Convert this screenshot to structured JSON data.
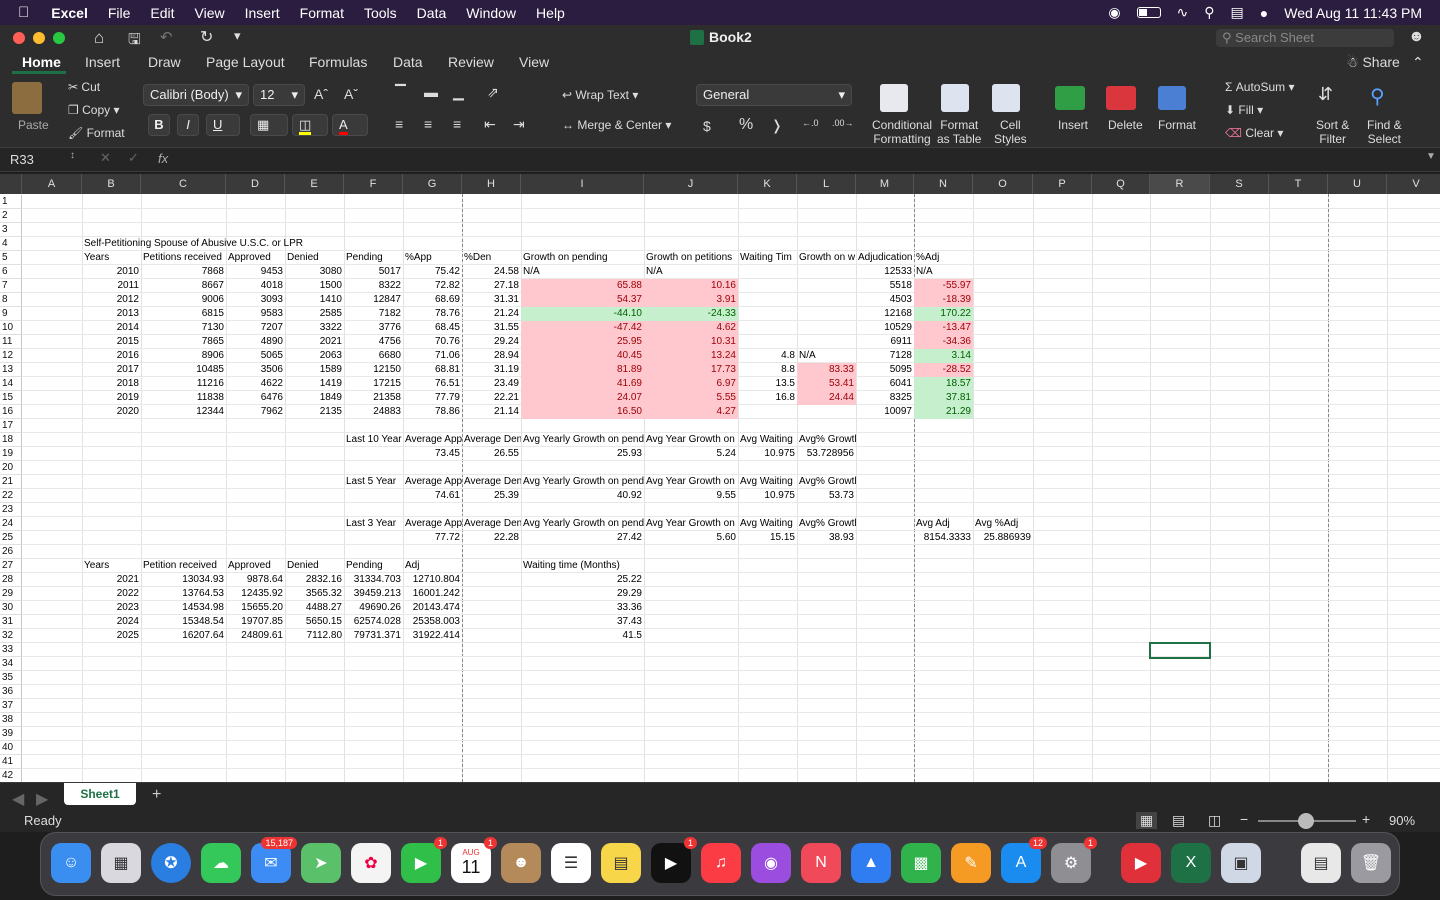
{
  "menubar": {
    "apple": "",
    "app": "Excel",
    "items": [
      "File",
      "Edit",
      "View",
      "Insert",
      "Format",
      "Tools",
      "Data",
      "Window",
      "Help"
    ],
    "clock": "Wed Aug 11  11:43 PM"
  },
  "window": {
    "title": "Book2"
  },
  "search": {
    "placeholder": "Search Sheet"
  },
  "share": {
    "label": "Share"
  },
  "ribbon_tabs": [
    "Home",
    "Insert",
    "Draw",
    "Page Layout",
    "Formulas",
    "Data",
    "Review",
    "View"
  ],
  "ribbon": {
    "paste": "Paste",
    "cut": "Cut",
    "copy": "Copy",
    "format_painter": "Format",
    "font_name": "Calibri (Body)",
    "font_size": "12",
    "bold": "B",
    "italic": "I",
    "underline": "U",
    "wrap_text": "Wrap Text",
    "merge_center": "Merge & Center",
    "number_format": "General",
    "currency": "$",
    "percent": "%",
    "comma": "❭",
    "conditional_formatting": [
      "Conditional",
      "Formatting"
    ],
    "format_as_table": [
      "Format",
      "as Table"
    ],
    "cell_styles": [
      "Cell",
      "Styles"
    ],
    "insert": "Insert",
    "delete": "Delete",
    "format": "Format",
    "autosum": "AutoSum",
    "fill": "Fill",
    "clear": "Clear",
    "sort_filter": [
      "Sort &",
      "Filter"
    ],
    "find_select": [
      "Find &",
      "Select"
    ]
  },
  "formula_bar": {
    "name_box": "R33",
    "fx": "fx",
    "content": ""
  },
  "columns": [
    "A",
    "B",
    "C",
    "D",
    "E",
    "F",
    "G",
    "H",
    "I",
    "J",
    "K",
    "L",
    "M",
    "N",
    "O",
    "P",
    "Q",
    "R",
    "S",
    "T",
    "U",
    "V"
  ],
  "rows": [
    "1",
    "2",
    "3",
    "4",
    "5",
    "6",
    "7",
    "8",
    "9",
    "10",
    "11",
    "12",
    "13",
    "14",
    "15",
    "16",
    "17",
    "18",
    "19",
    "20",
    "21",
    "22",
    "23",
    "24",
    "25",
    "26",
    "27",
    "28",
    "29",
    "30",
    "31",
    "32",
    "33",
    "34",
    "35",
    "36",
    "37",
    "38",
    "39",
    "40",
    "41",
    "42"
  ],
  "cells": {
    "B4": "Self-Petitioning Spouse of Abusive U.S.C. or LPR",
    "B5": "Years",
    "C5": "Petitions received",
    "D5": "Approved",
    "E5": "Denied",
    "F5": "Pending",
    "G5": "%App",
    "H5": "%Den",
    "I5": "Growth on pending",
    "J5": "Growth on petitions",
    "K5": "Waiting Tim",
    "L5": "Growth on w",
    "M5": "Adjudication",
    "N5": "%Adj",
    "B6": "2010",
    "C6": "7868",
    "D6": "9453",
    "E6": "3080",
    "F6": "5017",
    "G6": "75.42",
    "H6": "24.58",
    "I6": "N/A",
    "J6": "N/A",
    "M6": "12533",
    "N6": "N/A",
    "B7": "2011",
    "C7": "8667",
    "D7": "4018",
    "E7": "1500",
    "F7": "8322",
    "G7": "72.82",
    "H7": "27.18",
    "I7": "65.88",
    "J7": "10.16",
    "M7": "5518",
    "N7": "-55.97",
    "B8": "2012",
    "C8": "9006",
    "D8": "3093",
    "E8": "1410",
    "F8": "12847",
    "G8": "68.69",
    "H8": "31.31",
    "I8": "54.37",
    "J8": "3.91",
    "M8": "4503",
    "N8": "-18.39",
    "B9": "2013",
    "C9": "6815",
    "D9": "9583",
    "E9": "2585",
    "F9": "7182",
    "G9": "78.76",
    "H9": "21.24",
    "I9": "-44.10",
    "J9": "-24.33",
    "M9": "12168",
    "N9": "170.22",
    "B10": "2014",
    "C10": "7130",
    "D10": "7207",
    "E10": "3322",
    "F10": "3776",
    "G10": "68.45",
    "H10": "31.55",
    "I10": "-47.42",
    "J10": "4.62",
    "M10": "10529",
    "N10": "-13.47",
    "B11": "2015",
    "C11": "7865",
    "D11": "4890",
    "E11": "2021",
    "F11": "4756",
    "G11": "70.76",
    "H11": "29.24",
    "I11": "25.95",
    "J11": "10.31",
    "M11": "6911",
    "N11": "-34.36",
    "B12": "2016",
    "C12": "8906",
    "D12": "5065",
    "E12": "2063",
    "F12": "6680",
    "G12": "71.06",
    "H12": "28.94",
    "I12": "40.45",
    "J12": "13.24",
    "K12": "4.8",
    "L12": "N/A",
    "M12": "7128",
    "N12": "3.14",
    "B13": "2017",
    "C13": "10485",
    "D13": "3506",
    "E13": "1589",
    "F13": "12150",
    "G13": "68.81",
    "H13": "31.19",
    "I13": "81.89",
    "J13": "17.73",
    "K13": "8.8",
    "L13": "83.33",
    "M13": "5095",
    "N13": "-28.52",
    "B14": "2018",
    "C14": "11216",
    "D14": "4622",
    "E14": "1419",
    "F14": "17215",
    "G14": "76.51",
    "H14": "23.49",
    "I14": "41.69",
    "J14": "6.97",
    "K14": "13.5",
    "L14": "53.41",
    "M14": "6041",
    "N14": "18.57",
    "B15": "2019",
    "C15": "11838",
    "D15": "6476",
    "E15": "1849",
    "F15": "21358",
    "G15": "77.79",
    "H15": "22.21",
    "I15": "24.07",
    "J15": "5.55",
    "K15": "16.8",
    "L15": "24.44",
    "M15": "8325",
    "N15": "37.81",
    "B16": "2020",
    "C16": "12344",
    "D16": "7962",
    "E16": "2135",
    "F16": "24883",
    "G16": "78.86",
    "H16": "21.14",
    "I16": "16.50",
    "J16": "4.27",
    "M16": "10097",
    "N16": "21.29",
    "F18": "Last 10 Year",
    "G18": "Average App",
    "H18": "Average Den",
    "I18": "Avg Yearly Growth on pend",
    "J18": "Avg Year Growth on",
    "K18": "Avg Waiting",
    "L18": "Avg% Growth on wait",
    "G19": "73.45",
    "H19": "26.55",
    "I19": "25.93",
    "J19": "5.24",
    "K19": "10.975",
    "L19": "53.728956",
    "F21": "Last 5 Year",
    "G21": "Average App",
    "H21": "Average Den",
    "I21": "Avg Yearly Growth on pend",
    "J21": "Avg Year Growth on",
    "K21": "Avg Waiting",
    "L21": "Avg% Growth on wait",
    "G22": "74.61",
    "H22": "25.39",
    "I22": "40.92",
    "J22": "9.55",
    "K22": "10.975",
    "L22": "53.73",
    "F24": "Last 3 Year",
    "G24": "Average App",
    "H24": "Average Den",
    "I24": "Avg Yearly Growth on pend",
    "J24": "Avg Year Growth on",
    "K24": "Avg Waiting",
    "L24": "Avg% Growth on wait",
    "N24": "Avg Adj",
    "O24": "Avg %Adj",
    "G25": "77.72",
    "H25": "22.28",
    "I25": "27.42",
    "J25": "5.60",
    "K25": "15.15",
    "L25": "38.93",
    "N25": "8154.3333",
    "O25": "25.886939",
    "B27": "Years",
    "C27": "Petition received",
    "D27": "Approved",
    "E27": "Denied",
    "F27": "Pending",
    "G27": "Adj",
    "I27": "Waiting time (Months)",
    "B28": "2021",
    "C28": "13034.93",
    "D28": "9878.64",
    "E28": "2832.16",
    "F28": "31334.703",
    "G28": "12710.804",
    "I28": "25.22",
    "B29": "2022",
    "C29": "13764.53",
    "D29": "12435.92",
    "E29": "3565.32",
    "F29": "39459.213",
    "G29": "16001.242",
    "I29": "29.29",
    "B30": "2023",
    "C30": "14534.98",
    "D30": "15655.20",
    "E30": "4488.27",
    "F30": "49690.26",
    "G30": "20143.474",
    "I30": "33.36",
    "B31": "2024",
    "C31": "15348.54",
    "D31": "19707.85",
    "E31": "5650.15",
    "F31": "62574.028",
    "G31": "25358.003",
    "I31": "37.43",
    "B32": "2025",
    "C32": "16207.64",
    "D32": "24809.61",
    "E32": "7112.80",
    "F32": "79731.371",
    "G32": "31922.414",
    "I32": "41.5"
  },
  "pink_cells": [
    "I7",
    "I8",
    "I10",
    "I11",
    "I12",
    "I13",
    "I14",
    "I15",
    "I16",
    "J7",
    "J8",
    "J10",
    "J11",
    "J12",
    "J13",
    "J14",
    "J15",
    "J16",
    "L13",
    "L14",
    "L15",
    "N7",
    "N8",
    "N10",
    "N11",
    "N13"
  ],
  "green_cells": [
    "I9",
    "J9",
    "N9",
    "N12",
    "N14",
    "N15",
    "N16"
  ],
  "selected_cell": "R33",
  "sheet_tab": "Sheet1",
  "status": {
    "ready": "Ready",
    "zoom": "90%"
  },
  "dock": {
    "apps": [
      "Finder",
      "Launchpad",
      "Safari",
      "Messages",
      "Mail",
      "Maps",
      "Photos",
      "FaceTime",
      "Calendar",
      "Contacts",
      "Reminders",
      "Notes",
      "TV",
      "Music",
      "Podcasts",
      "News",
      "Keynote",
      "Numbers",
      "Pages",
      "App Store",
      "System Preferences",
      "PDF Expert",
      "Excel",
      "Preview",
      "Documents",
      "Trash"
    ],
    "mail_badge": "15,187",
    "facetime_badge": "1",
    "calendar_badge": "1",
    "calendar_month": "AUG",
    "calendar_day": "11",
    "tv_badge": "1",
    "appstore_badge": "12",
    "sysprefs_badge": "1"
  },
  "colors": {
    "pink_fill": "#ffc7ce",
    "pink_text": "#9c0006",
    "green_fill": "#c6efce",
    "green_text": "#006100",
    "menubar": "#2b1d40",
    "selection": "#1e7145"
  }
}
